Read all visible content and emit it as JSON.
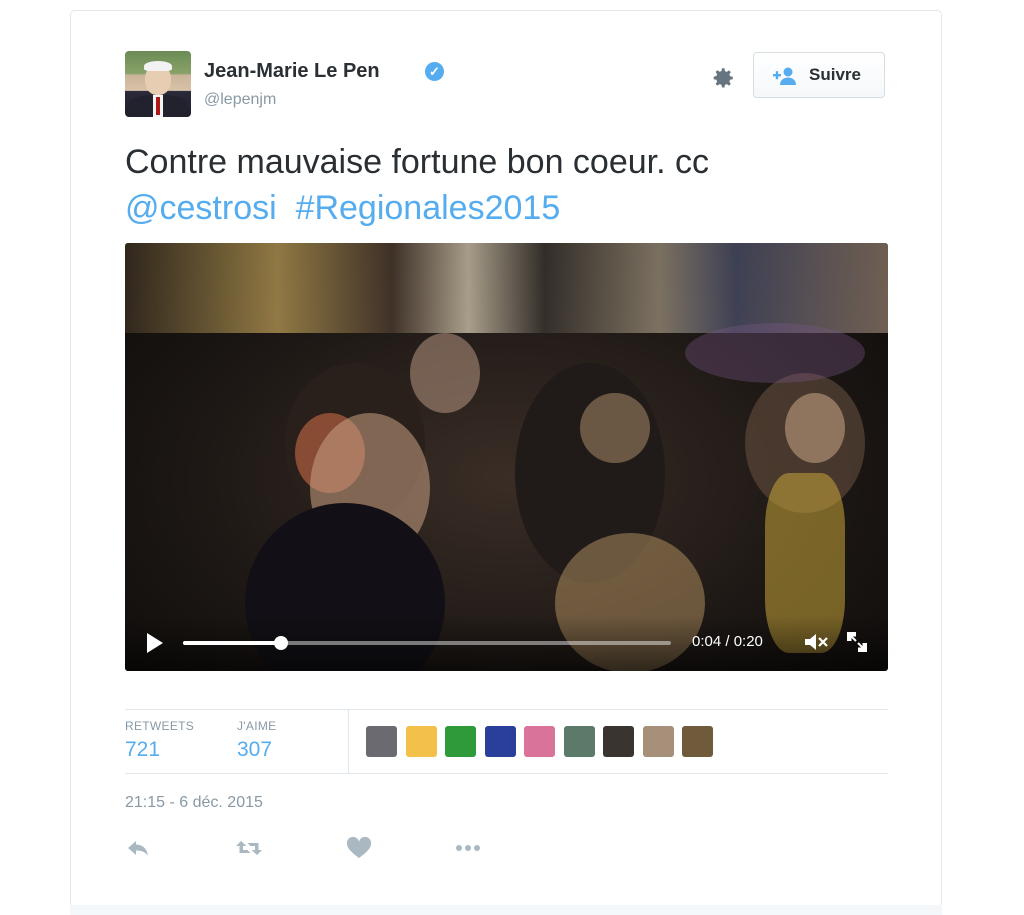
{
  "author": {
    "display_name": "Jean-Marie Le Pen",
    "handle": "@lepenjm",
    "verified": true
  },
  "header": {
    "follow_label": "Suivre"
  },
  "tweet": {
    "text_main": "Contre mauvaise fortune bon coeur.  cc",
    "mention": "@cestrosi",
    "hashtag": "#Regionales2015"
  },
  "video": {
    "current_time": "0:04",
    "duration": "0:20",
    "time_display": "0:04 / 0:20",
    "progress_fraction": 0.2,
    "muted": true
  },
  "stats": {
    "retweets_label": "RETWEETS",
    "retweets_value": "721",
    "likes_label": "J'AIME",
    "likes_value": "307"
  },
  "likers": [
    {
      "color": "#6b6a70"
    },
    {
      "color": "#f3c04a"
    },
    {
      "color": "#2e9a3a"
    },
    {
      "color": "#2a3f9a"
    },
    {
      "color": "#d9739a"
    },
    {
      "color": "#5c7a6a"
    },
    {
      "color": "#3a3430"
    },
    {
      "color": "#a6907a"
    },
    {
      "color": "#6f5a3c"
    }
  ],
  "timestamp": "21:15 - 6 déc. 2015",
  "colors": {
    "accent": "#55acee",
    "text": "#292f33",
    "muted": "#8899a6"
  }
}
